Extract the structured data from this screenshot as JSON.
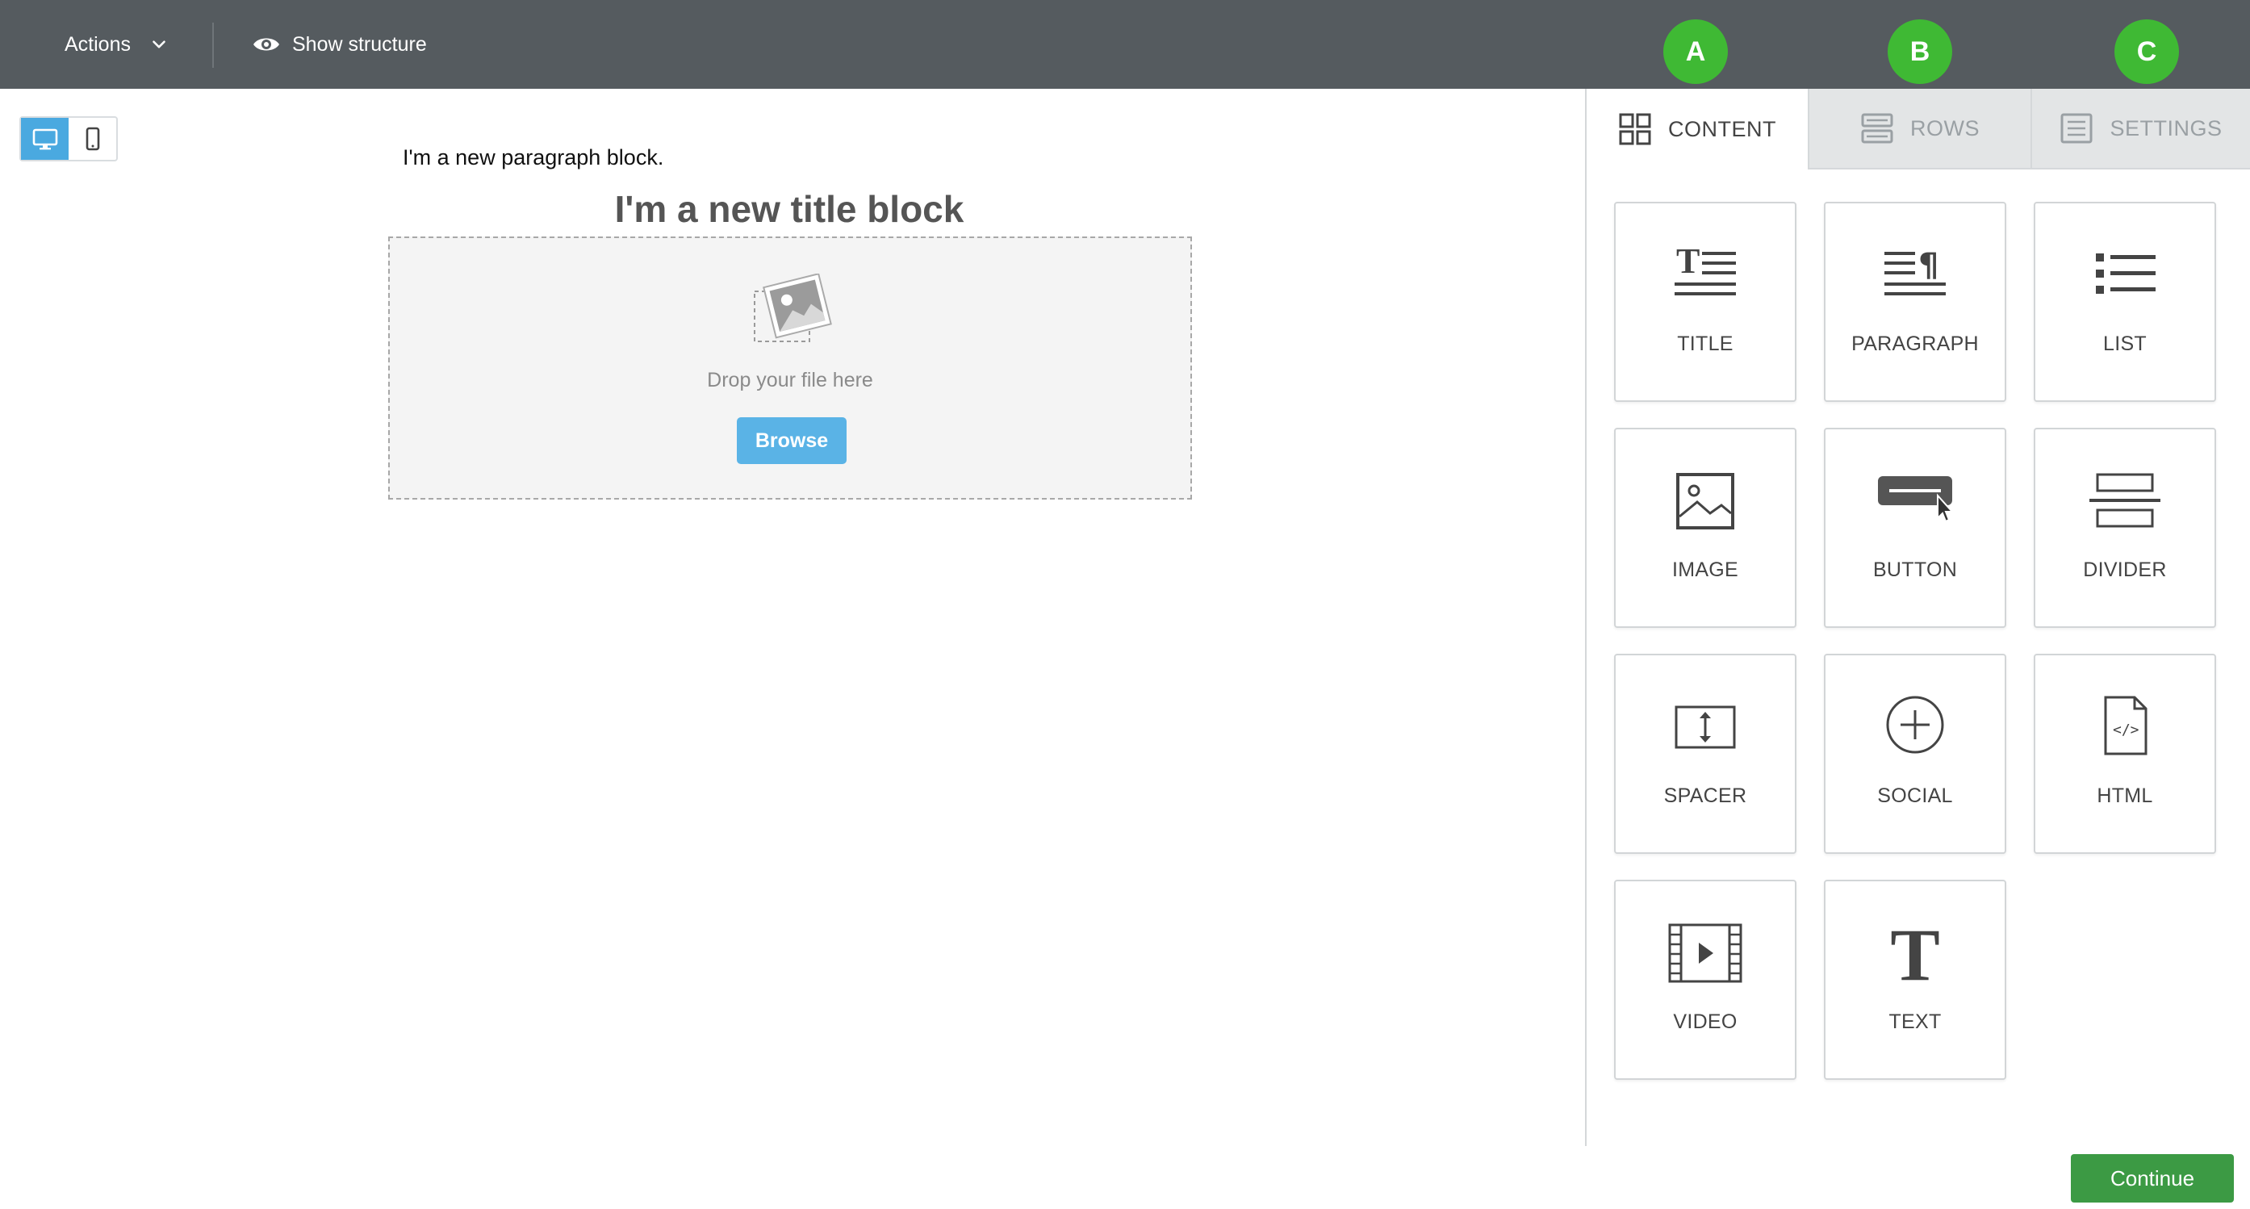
{
  "toolbar": {
    "actions_label": "Actions",
    "show_structure_label": "Show structure"
  },
  "annotations": {
    "a": "A",
    "b": "B",
    "c": "C",
    "color": "#3fb934"
  },
  "device_toggle": {
    "selected": "desktop",
    "options": [
      "desktop",
      "mobile"
    ]
  },
  "canvas": {
    "paragraph_text": "I'm a new paragraph block.",
    "title_text": "I'm a new title block",
    "dropzone_text": "Drop your file here",
    "browse_label": "Browse"
  },
  "panel": {
    "tabs": [
      {
        "label": "CONTENT",
        "icon": "grid-icon",
        "active": true
      },
      {
        "label": "ROWS",
        "icon": "rows-icon",
        "active": false
      },
      {
        "label": "SETTINGS",
        "icon": "settings-list-icon",
        "active": false
      }
    ],
    "blocks": [
      {
        "label": "TITLE",
        "icon": "title-icon"
      },
      {
        "label": "PARAGRAPH",
        "icon": "paragraph-icon"
      },
      {
        "label": "LIST",
        "icon": "list-icon"
      },
      {
        "label": "IMAGE",
        "icon": "image-icon"
      },
      {
        "label": "BUTTON",
        "icon": "button-icon"
      },
      {
        "label": "DIVIDER",
        "icon": "divider-icon"
      },
      {
        "label": "SPACER",
        "icon": "spacer-icon"
      },
      {
        "label": "SOCIAL",
        "icon": "social-icon"
      },
      {
        "label": "HTML",
        "icon": "html-icon"
      },
      {
        "label": "VIDEO",
        "icon": "video-icon"
      },
      {
        "label": "TEXT",
        "icon": "text-icon"
      }
    ]
  },
  "footer": {
    "continue_label": "Continue"
  },
  "colors": {
    "topbar": "#555b5f",
    "accent_blue": "#4aa9e0",
    "continue_green": "#3c9a44"
  }
}
